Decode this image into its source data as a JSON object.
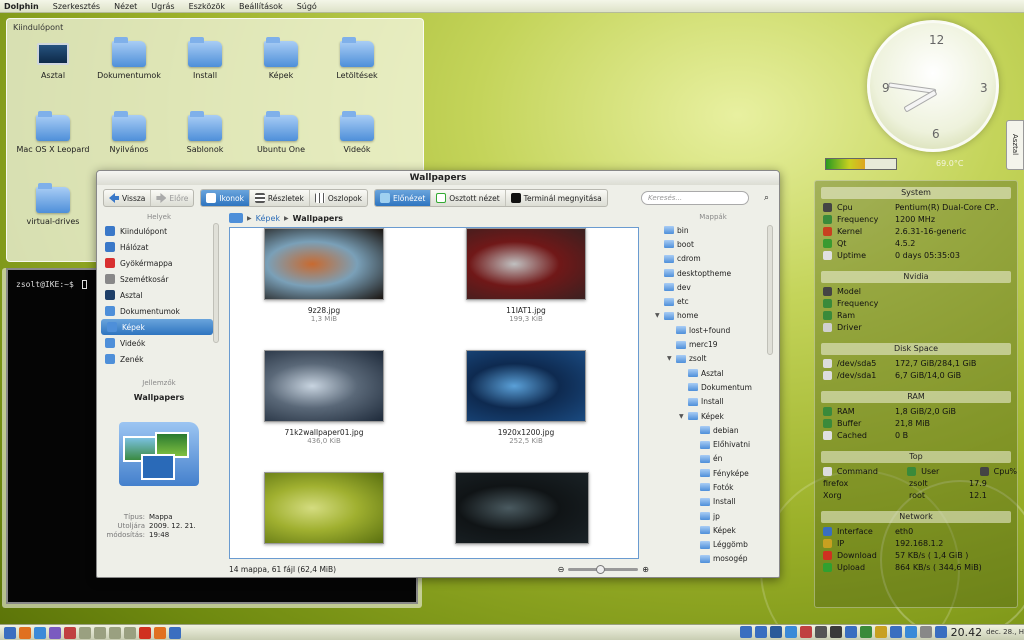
{
  "menubar": {
    "app": "Dolphin",
    "items": [
      "Szerkesztés",
      "Nézet",
      "Ugrás",
      "Eszközök",
      "Beállítások",
      "Súgó"
    ]
  },
  "desktop": {
    "title": "Kiindulópont",
    "icons": [
      {
        "label": "Asztal",
        "kind": "monitor"
      },
      {
        "label": "Dokumentumok",
        "kind": "folder"
      },
      {
        "label": "Install",
        "kind": "folder"
      },
      {
        "label": "Képek",
        "kind": "folder"
      },
      {
        "label": "Letöltések",
        "kind": "folder"
      },
      {
        "label": "Mac OS X Leopard",
        "kind": "folder"
      },
      {
        "label": "Nyilvános",
        "kind": "folder"
      },
      {
        "label": "Sablonok",
        "kind": "folder"
      },
      {
        "label": "Ubuntu One",
        "kind": "folder"
      },
      {
        "label": "Videók",
        "kind": "folder"
      },
      {
        "label": "virtual-drives",
        "kind": "folder"
      }
    ]
  },
  "terminal": {
    "prompt": "zsolt@IKE:~$"
  },
  "clock_widget": {
    "numerals": [
      "12",
      "3",
      "6",
      "9"
    ]
  },
  "temperature": {
    "value": "69.0°C",
    "level": 0.55
  },
  "side_tab": {
    "label": "Asztal"
  },
  "sysmon": {
    "system": {
      "title": "System",
      "rows": [
        {
          "label": "Cpu",
          "value": "Pentium(R) Dual-Core CP..",
          "icon": "cpu-icon"
        },
        {
          "label": "Frequency",
          "value": "1200 MHz",
          "icon": "frequency-icon"
        },
        {
          "label": "Kernel",
          "value": "2.6.31-16-generic",
          "icon": "kernel-icon"
        },
        {
          "label": "Qt",
          "value": "4.5.2",
          "icon": "qt-icon"
        },
        {
          "label": "Uptime",
          "value": "0 days 05:35:03",
          "icon": "uptime-icon"
        }
      ]
    },
    "nvidia": {
      "title": "Nvidia",
      "rows": [
        {
          "label": "Model",
          "value": "",
          "icon": "model-icon"
        },
        {
          "label": "Frequency",
          "value": "",
          "icon": "frequency-icon"
        },
        {
          "label": "Ram",
          "value": "",
          "icon": "ram-icon"
        },
        {
          "label": "Driver",
          "value": "",
          "icon": "driver-icon"
        }
      ]
    },
    "disk": {
      "title": "Disk Space",
      "rows": [
        {
          "label": "/dev/sda5",
          "value": "172,7 GiB/284,1 GiB",
          "icon": "disk-icon"
        },
        {
          "label": "/dev/sda1",
          "value": "6,7 GiB/14,0 GiB",
          "icon": "disk-icon"
        }
      ]
    },
    "ram": {
      "title": "RAM",
      "rows": [
        {
          "label": "RAM",
          "value": "1,8 GiB/2,0 GiB",
          "icon": "ram-icon"
        },
        {
          "label": "Buffer",
          "value": "21,8 MiB",
          "icon": "buffer-icon"
        },
        {
          "label": "Cached",
          "value": "0 B",
          "icon": "cached-icon"
        }
      ]
    },
    "top": {
      "title": "Top",
      "headers": [
        "Command",
        "User",
        "Cpu%"
      ],
      "rows": [
        [
          "firefox",
          "zsolt",
          "17.9"
        ],
        [
          "Xorg",
          "root",
          "12.1"
        ]
      ]
    },
    "network": {
      "title": "Network",
      "rows": [
        {
          "label": "Interface",
          "value": "eth0",
          "icon": "interface-icon"
        },
        {
          "label": "IP",
          "value": "192.168.1.2",
          "icon": "ip-icon"
        },
        {
          "label": "Download",
          "value": "57 KB/s ( 1,4 GiB )",
          "icon": "download-icon"
        },
        {
          "label": "Upload",
          "value": "864 KB/s ( 344,6 MiB)",
          "icon": "upload-icon"
        }
      ]
    }
  },
  "dolphin": {
    "title": "Wallpapers",
    "toolbar": {
      "back": "Vissza",
      "forward": "Előre",
      "icons": "Ikonok",
      "details": "Részletek",
      "columns": "Oszlopok",
      "preview": "Előnézet",
      "split": "Osztott nézet",
      "terminal": "Terminál megnyitása"
    },
    "search_placeholder": "Keresés...",
    "places": {
      "title": "Helyek",
      "items": [
        {
          "label": "Kiindulópont",
          "color": "#3a78c8"
        },
        {
          "label": "Hálózat",
          "color": "#3a78c8"
        },
        {
          "label": "Gyökérmappa",
          "color": "#d83030"
        },
        {
          "label": "Szemétkosár",
          "color": "#888888"
        },
        {
          "label": "Asztal",
          "color": "#1e3e66"
        },
        {
          "label": "Dokumentumok",
          "color": "#4e8fd9"
        },
        {
          "label": "Képek",
          "color": "#4e8fd9"
        },
        {
          "label": "Videók",
          "color": "#4e8fd9"
        },
        {
          "label": "Zenék",
          "color": "#4e8fd9"
        }
      ],
      "selected_index": 6
    },
    "info": {
      "title": "Jellemzők",
      "name": "Wallpapers",
      "type_label": "Típus:",
      "type_value": "Mappa",
      "modified_label": "Utoljára módosítás:",
      "modified_value": "2009. 12. 21. 19:48"
    },
    "breadcrumb": [
      "Képek",
      "Wallpapers"
    ],
    "files": [
      {
        "name": "9z28.jpg",
        "size": "1,3 MiB",
        "colors": [
          "#1a1410",
          "#c86a30",
          "#7aa0b8"
        ]
      },
      {
        "name": "11IAT1.jpg",
        "size": "199,3 KiB",
        "colors": [
          "#3a2020",
          "#c0c0c0",
          "#701818"
        ]
      },
      {
        "name": "71k2wallpaper01.jpg",
        "size": "436,0 KiB",
        "colors": [
          "#1e2a3a",
          "#c8d4e0",
          "#5a6878"
        ]
      },
      {
        "name": "1920x1200.jpg",
        "size": "252,5 KiB",
        "colors": [
          "#1a4a80",
          "#5aa0d8",
          "#0e2a50"
        ]
      },
      {
        "name": "",
        "size": "",
        "colors": [
          "#5a7010",
          "#d4dc80",
          "#a0b030"
        ]
      },
      {
        "name": "",
        "size": "",
        "colors": [
          "#1a2226",
          "#4a5a60",
          "#101416"
        ]
      }
    ],
    "folders_panel": {
      "title": "Mappák",
      "items": [
        {
          "label": "bin",
          "depth": 0
        },
        {
          "label": "boot",
          "depth": 0
        },
        {
          "label": "cdrom",
          "depth": 0
        },
        {
          "label": "desktoptheme",
          "depth": 0
        },
        {
          "label": "dev",
          "depth": 0
        },
        {
          "label": "etc",
          "depth": 0
        },
        {
          "label": "home",
          "depth": 0,
          "open": true
        },
        {
          "label": "lost+found",
          "depth": 1
        },
        {
          "label": "merc19",
          "depth": 1
        },
        {
          "label": "zsolt",
          "depth": 1,
          "open": true
        },
        {
          "label": "Asztal",
          "depth": 2
        },
        {
          "label": "Dokumentum",
          "depth": 2
        },
        {
          "label": "Install",
          "depth": 2
        },
        {
          "label": "Képek",
          "depth": 2,
          "open": true
        },
        {
          "label": "debian",
          "depth": 3
        },
        {
          "label": "Előhivatni",
          "depth": 3
        },
        {
          "label": "én",
          "depth": 3
        },
        {
          "label": "Fényképe",
          "depth": 3
        },
        {
          "label": "Fotók",
          "depth": 3
        },
        {
          "label": "Install",
          "depth": 3
        },
        {
          "label": "jp",
          "depth": 3
        },
        {
          "label": "Képek",
          "depth": 3
        },
        {
          "label": "Léggömb",
          "depth": 3
        },
        {
          "label": "mosogép",
          "depth": 3
        }
      ]
    },
    "status": "14 mappa, 61 fájl (62,4 MiB)"
  },
  "taskbar": {
    "time": "20.42",
    "date": "dec. 28., H",
    "launchers": [
      "#3a6ec0",
      "#e07020",
      "#3a8ad8",
      "#7a5ac0",
      "#c04040",
      "#9aa080",
      "#9aa080",
      "#9aa080",
      "#9aa080",
      "#d03020",
      "#e07020",
      "#3a6ec0"
    ],
    "tray": [
      "#3a6ec0",
      "#3a6ec0",
      "#2a5a9a",
      "#3a8ad8",
      "#c04040",
      "#555555",
      "#3a3a3a",
      "#3a6ec0",
      "#3a8a3a",
      "#c8a020",
      "#3a6ec0",
      "#3a8ad8",
      "#888888",
      "#3a6ec0"
    ]
  }
}
